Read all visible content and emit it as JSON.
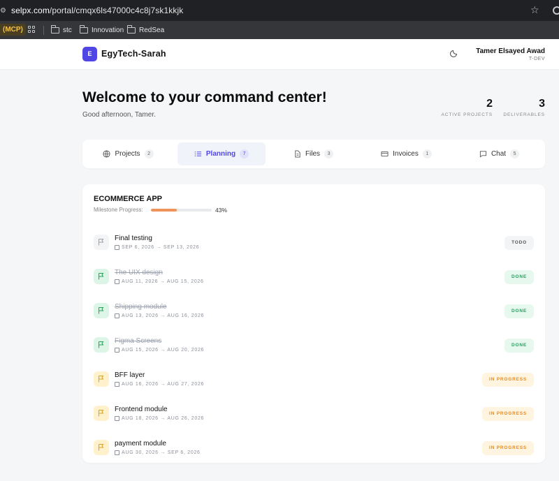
{
  "browser": {
    "url_host": "selpx.com",
    "url_path": "/portal/cmqx6ls47000c4c8j7sk1kkjk",
    "bookmarks": [
      {
        "label": "(MCP)"
      },
      {
        "label": "stc"
      },
      {
        "label": "Innovation"
      },
      {
        "label": "RedSea"
      }
    ]
  },
  "header": {
    "logo_letter": "E",
    "brand": "EgyTech-Sarah",
    "user_name": "Tamer Elsayed Awad",
    "user_role": "T-DEV"
  },
  "hero": {
    "title": "Welcome to your command center!",
    "greeting": "Good afternoon, Tamer.",
    "stats": [
      {
        "value": "2",
        "label": "ACTIVE PROJECTS"
      },
      {
        "value": "3",
        "label": "DELIVERABLES"
      }
    ]
  },
  "tabs": [
    {
      "label": "Projects",
      "count": "2",
      "icon": "globe-icon"
    },
    {
      "label": "Planning",
      "count": "7",
      "icon": "list-icon",
      "active": true
    },
    {
      "label": "Files",
      "count": "3",
      "icon": "file-icon"
    },
    {
      "label": "Invoices",
      "count": "1",
      "icon": "card-icon"
    },
    {
      "label": "Chat",
      "count": "5",
      "icon": "chat-icon"
    }
  ],
  "project": {
    "title": "ECOMMERCE APP",
    "progress_label": "Milestone Progress:",
    "progress_pct_text": "43%",
    "progress_fraction": 0.43,
    "milestones": [
      {
        "name": "Final testing",
        "dates": "SEP 6, 2026 → SEP 13, 2026",
        "status": "TODO"
      },
      {
        "name": "The UIX design",
        "dates": "AUG 11, 2026 → AUG 15, 2026",
        "status": "DONE"
      },
      {
        "name": "Shipping module",
        "dates": "AUG 13, 2026 → AUG 16, 2026",
        "status": "DONE"
      },
      {
        "name": "Figma Screens",
        "dates": "AUG 15, 2026 → AUG 20, 2026",
        "status": "DONE"
      },
      {
        "name": "BFF layer",
        "dates": "AUG 16, 2026 → AUG 27, 2026",
        "status": "IN PROGRESS"
      },
      {
        "name": "Frontend module",
        "dates": "AUG 18, 2026 → AUG 26, 2026",
        "status": "IN PROGRESS"
      },
      {
        "name": "payment module",
        "dates": "AUG 30, 2026 → SEP 6, 2026",
        "status": "IN PROGRESS"
      }
    ]
  },
  "colors": {
    "accent": "#4f46e5",
    "progress": "#f0935a",
    "todo_bg": "#f3f4f6",
    "todo_fg": "#555555",
    "done_bg": "#e7f8ef",
    "done_fg": "#22a35a",
    "progress_bg": "#fff4e0",
    "progress_fg": "#e58a1f"
  }
}
